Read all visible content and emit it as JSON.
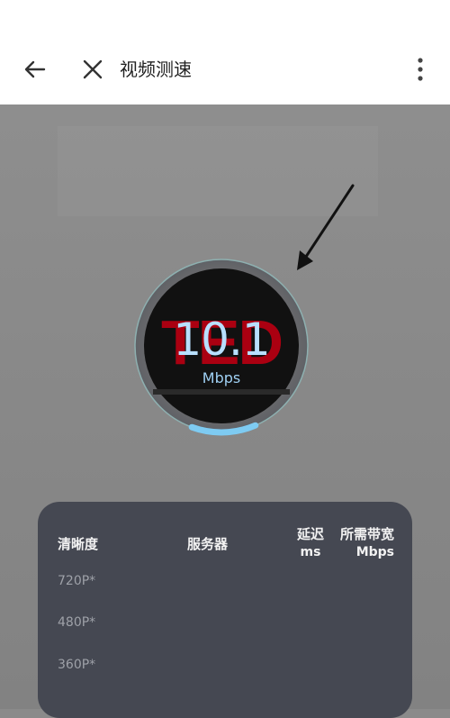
{
  "header": {
    "title": "视频测速",
    "icons": {
      "back": "back-arrow-icon",
      "close": "close-icon",
      "more": "more-vert-icon"
    }
  },
  "gauge": {
    "speed_value": "10.1",
    "speed_unit": "Mbps",
    "progress": 0.12,
    "accent_color": "#7ecbf2"
  },
  "results": {
    "columns": {
      "resolution": "清晰度",
      "server": "服务器",
      "latency": "延迟",
      "latency_unit": "ms",
      "bandwidth": "所需带宽",
      "bandwidth_unit": "Mbps"
    },
    "rows": [
      {
        "resolution": "720P*"
      },
      {
        "resolution": "480P*"
      },
      {
        "resolution": "360P*"
      }
    ]
  },
  "colors": {
    "background": "#8a8a8a",
    "panel": "#454852",
    "speed_text": "#b8dfff"
  }
}
